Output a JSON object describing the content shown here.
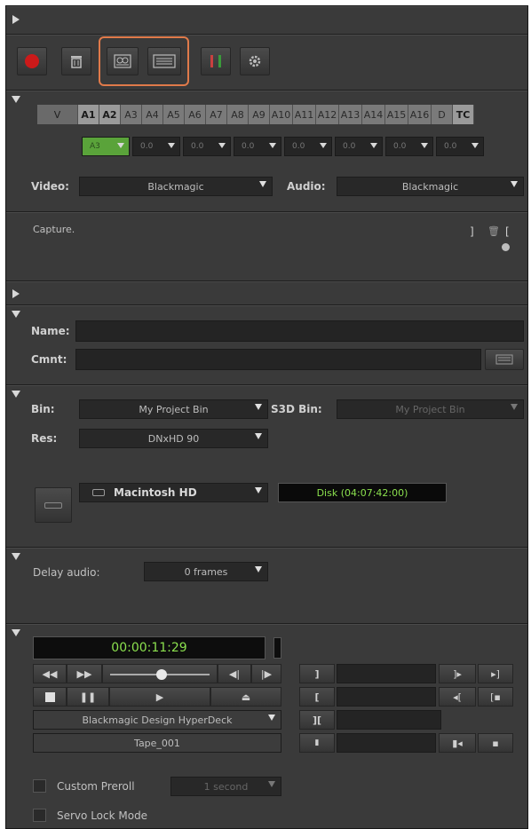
{
  "toolbar": {
    "buttons": [
      "record",
      "trash",
      "capture-settings",
      "tape-settings",
      "marker",
      "settings"
    ]
  },
  "tracks": {
    "labels": [
      "V",
      "A1",
      "A2",
      "A3",
      "A4",
      "A5",
      "A6",
      "A7",
      "A8",
      "A9",
      "A10",
      "A11",
      "A12",
      "A13",
      "A14",
      "A15",
      "A16",
      "D",
      "TC"
    ],
    "selected": [
      "A1",
      "A2",
      "TC"
    ],
    "channels": [
      "A3",
      "0.0",
      "0.0",
      "0.0",
      "0.0",
      "0.0",
      "0.0",
      "0.0"
    ]
  },
  "source": {
    "video_label": "Video:",
    "video_value": "Blackmagic",
    "audio_label": "Audio:",
    "audio_value": "Blackmagic"
  },
  "status": {
    "text": "Capture."
  },
  "clip": {
    "name_label": "Name:",
    "name_value": "",
    "comment_label": "Cmnt:",
    "comment_value": ""
  },
  "destination": {
    "bin_label": "Bin:",
    "bin_value": "My Project Bin",
    "s3d_label": "S3D Bin:",
    "s3d_value": "My Project Bin",
    "res_label": "Res:",
    "res_value": "DNxHD 90",
    "drive_value": "Macintosh HD",
    "disk_time": "Disk (04:07:42:00)"
  },
  "delay": {
    "label": "Delay audio:",
    "value": "0 frames"
  },
  "deck": {
    "timecode": "00:00:11:29",
    "deck_name": "Blackmagic Design HyperDeck",
    "tape_name": "Tape_001",
    "custom_preroll_label": "Custom Preroll",
    "custom_preroll_value": "1 second",
    "servo_lock_label": "Servo Lock Mode",
    "colors": {
      "timecode": "#8be04e",
      "record": "#cc1a1a"
    }
  }
}
